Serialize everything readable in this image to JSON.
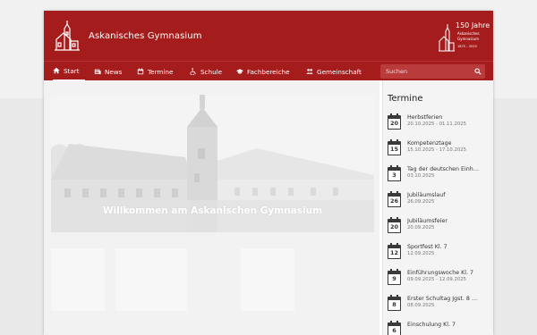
{
  "site": {
    "title": "Askanisches Gymnasium",
    "anniversary": {
      "headline": "150 Jahre",
      "line1": "Askanisches",
      "line2": "Gymnasium",
      "years": "1875 – 2025"
    }
  },
  "colors": {
    "brand": "#a51c1c",
    "nav_active_underline": "#ffffff"
  },
  "nav": {
    "items": [
      {
        "label": "Start",
        "icon": "home-icon",
        "active": true
      },
      {
        "label": "News",
        "icon": "newspaper-icon"
      },
      {
        "label": "Termine",
        "icon": "calendar-icon"
      },
      {
        "label": "Schule",
        "icon": "wheelchair-icon"
      },
      {
        "label": "Fachbereiche",
        "icon": "graduation-cap-icon"
      },
      {
        "label": "Gemeinschaft",
        "icon": "people-icon"
      }
    ],
    "search": {
      "placeholder": "Suchen",
      "value": "",
      "icon": "search-icon"
    }
  },
  "hero": {
    "caption": "Willkommen am Askanischen Gymnasium"
  },
  "sidebar": {
    "title": "Termine",
    "events": [
      {
        "day": "20",
        "title": "Herbstferien",
        "date": "20.10.2025 - 01.11.2025"
      },
      {
        "day": "15",
        "title": "Kompetenztage",
        "date": "15.10.2025 - 17.10.2025"
      },
      {
        "day": "3",
        "title": "Tag der deutschen Einh…",
        "date": "03.10.2025"
      },
      {
        "day": "26",
        "title": "Jubiläumslauf",
        "date": "26.09.2025"
      },
      {
        "day": "20",
        "title": "Jubiläumsfeier",
        "date": "20.09.2025"
      },
      {
        "day": "12",
        "title": "Sportfest Kl. 7",
        "date": "12.09.2025"
      },
      {
        "day": "9",
        "title": "Einführungswoche Kl. 7",
        "date": "09.09.2025 - 12.09.2025"
      },
      {
        "day": "8",
        "title": "Erster Schultag Jgst. 8 …",
        "date": "08.09.2025"
      },
      {
        "day": "6",
        "title": "Einschulung Kl. 7",
        "date": ""
      }
    ]
  }
}
